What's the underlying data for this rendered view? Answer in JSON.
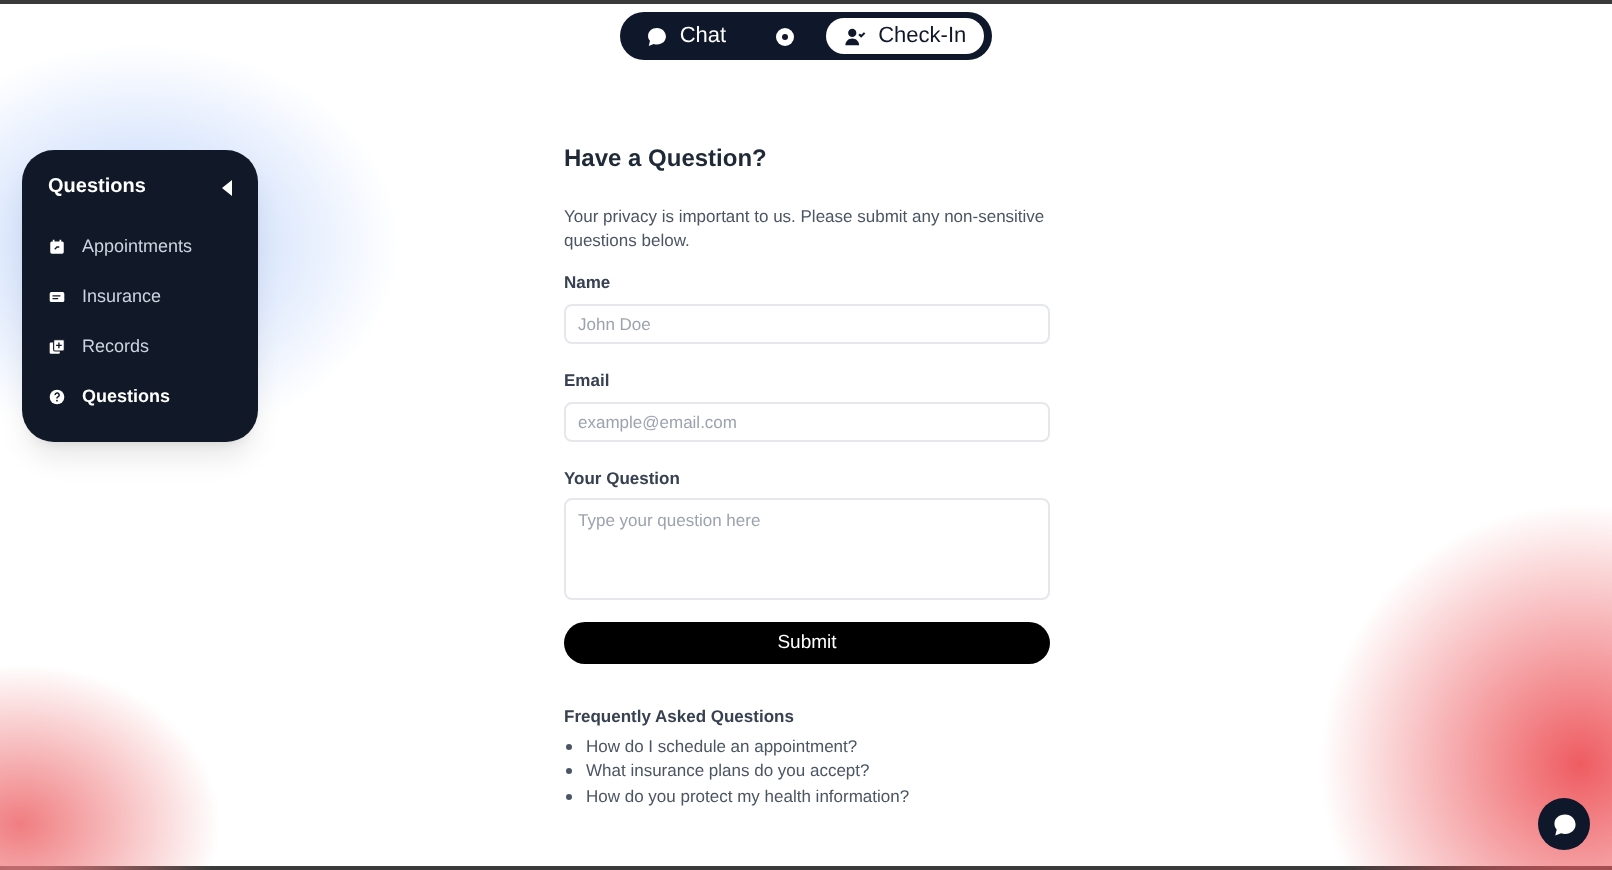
{
  "mode_switch": {
    "tabs": [
      {
        "label": "Chat",
        "kind": "chat",
        "selected": false
      },
      {
        "label": "Check-In",
        "kind": "checkin",
        "selected": true
      }
    ]
  },
  "sidebar": {
    "title": "Questions",
    "items": [
      {
        "label": "Appointments",
        "kind": "calendar",
        "selected": false
      },
      {
        "label": "Insurance",
        "kind": "card",
        "selected": false
      },
      {
        "label": "Records",
        "kind": "records",
        "selected": false
      },
      {
        "label": "Questions",
        "kind": "question",
        "selected": true
      }
    ]
  },
  "form": {
    "title": "Have a Question?",
    "intro": "Your privacy is important to us. Please submit any non-sensitive questions below.",
    "fields": [
      {
        "label": "Name",
        "placeholder": "John Doe",
        "kind": "text"
      },
      {
        "label": "Email",
        "placeholder": "example@email.com",
        "kind": "text"
      },
      {
        "label": "Your Question",
        "placeholder": "Type your question here",
        "kind": "textarea"
      }
    ],
    "submit": "Submit"
  },
  "faq": {
    "title": "Frequently Asked Questions",
    "items": [
      "How do I schedule an appointment?",
      "What insurance plans do you accept?",
      "How do you protect my health information?"
    ]
  }
}
